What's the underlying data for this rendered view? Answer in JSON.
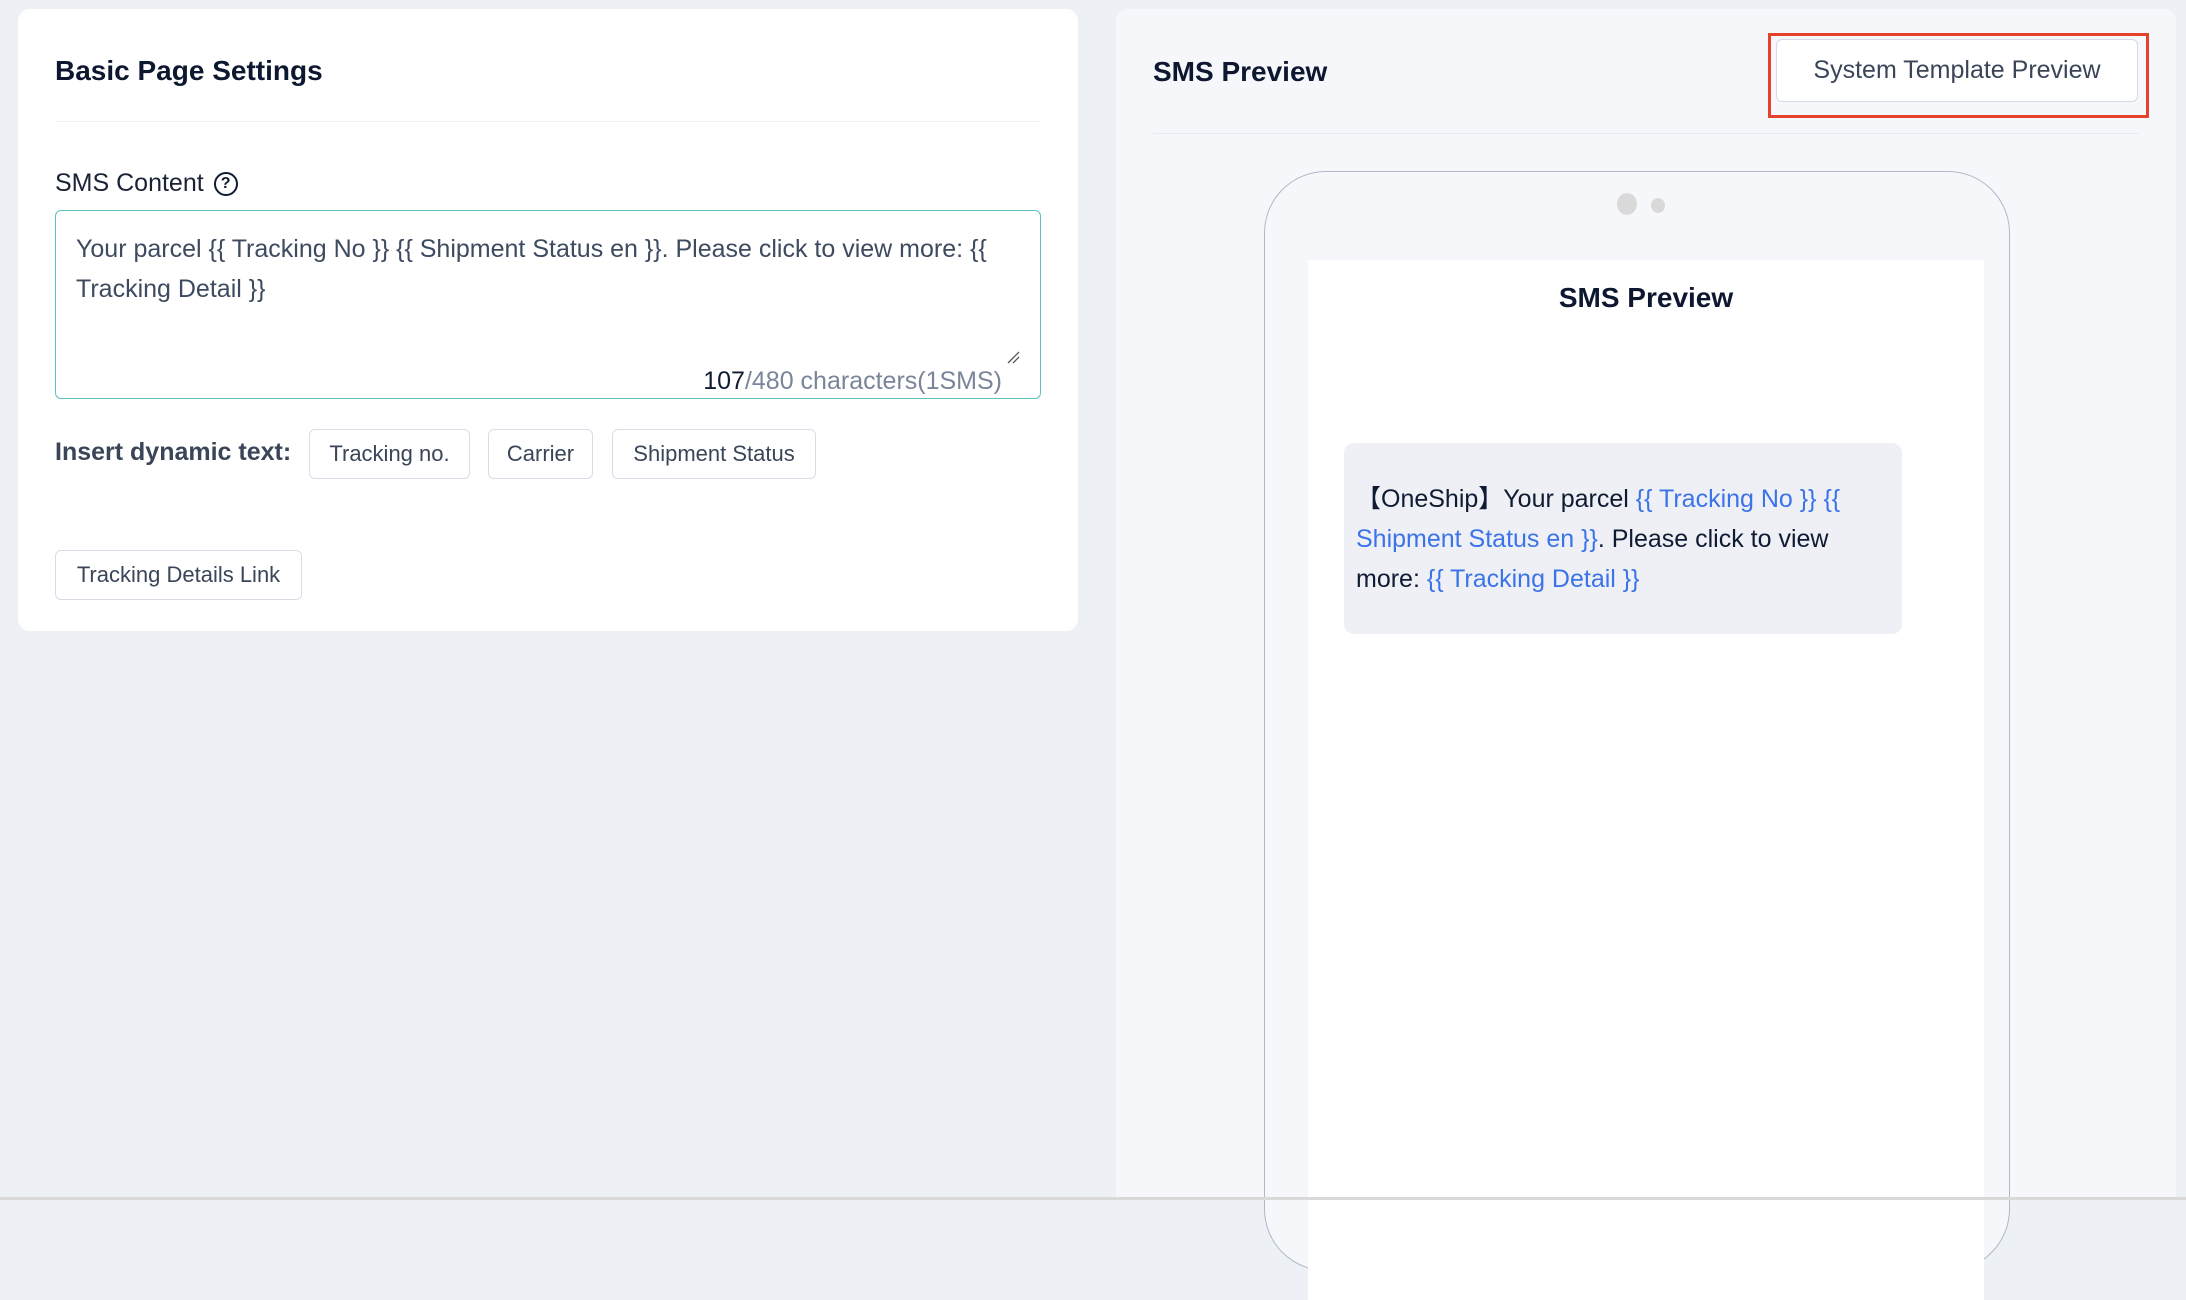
{
  "left_panel": {
    "title": "Basic Page Settings",
    "sms_content": {
      "label": "SMS Content",
      "help_icon": "question-circle-icon",
      "value": "Your parcel {{ Tracking No }} {{ Shipment Status en }}. Please click to view more: {{ Tracking Detail }}",
      "char_count": "107",
      "char_limit_text": "/480 characters(1SMS)"
    },
    "insert_dynamic": {
      "label": "Insert dynamic text:",
      "buttons": [
        "Tracking no.",
        "Carrier",
        "Shipment Status",
        "Tracking Details Link"
      ]
    }
  },
  "right_panel": {
    "title": "SMS Preview",
    "system_template_button": "System Template Preview",
    "phone": {
      "screen_title": "SMS Preview",
      "message": {
        "prefix": "【OneShip】Your parcel ",
        "var1": "{{ Tracking No }}",
        "sep1": " ",
        "var2": "{{ Shipment Status en }}",
        "mid": ". Please click to view more: ",
        "var3": "{{ Tracking Detail }}"
      }
    }
  },
  "colors": {
    "accent_border": "#5cc3c0",
    "variable_link": "#3b73e8",
    "highlight": "#e5412b"
  }
}
